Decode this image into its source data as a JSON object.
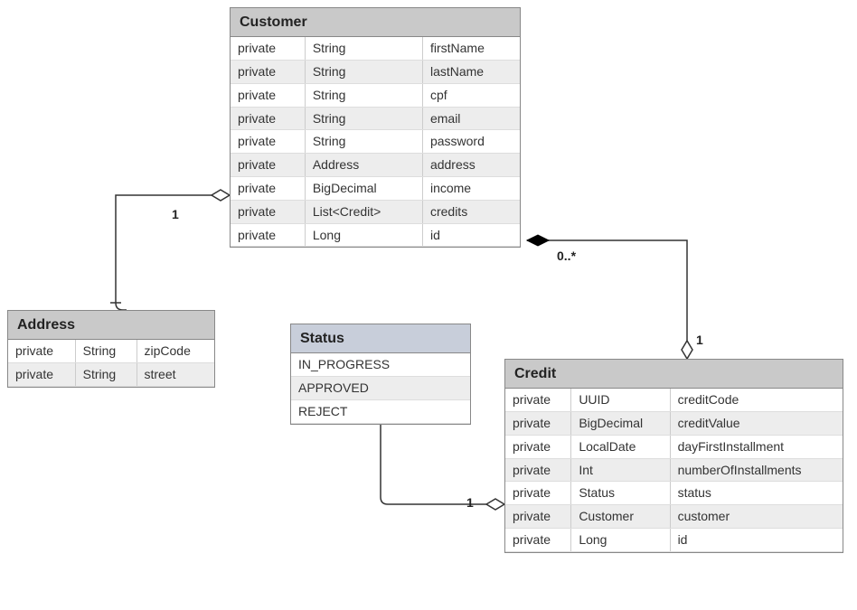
{
  "classes": {
    "customer": {
      "name": "Customer",
      "attributes": [
        {
          "vis": "private",
          "type": "String",
          "name": "firstName"
        },
        {
          "vis": "private",
          "type": "String",
          "name": "lastName"
        },
        {
          "vis": "private",
          "type": "String",
          "name": "cpf"
        },
        {
          "vis": "private",
          "type": "String",
          "name": "email"
        },
        {
          "vis": "private",
          "type": "String",
          "name": "password"
        },
        {
          "vis": "private",
          "type": "Address",
          "name": "address"
        },
        {
          "vis": "private",
          "type": "BigDecimal",
          "name": "income"
        },
        {
          "vis": "private",
          "type": "List<Credit>",
          "name": "credits"
        },
        {
          "vis": "private",
          "type": "Long",
          "name": "id"
        }
      ]
    },
    "address": {
      "name": "Address",
      "attributes": [
        {
          "vis": "private",
          "type": "String",
          "name": "zipCode"
        },
        {
          "vis": "private",
          "type": "String",
          "name": "street"
        }
      ]
    },
    "status": {
      "name": "Status",
      "values": [
        "IN_PROGRESS",
        "APPROVED",
        "REJECT"
      ]
    },
    "credit": {
      "name": "Credit",
      "attributes": [
        {
          "vis": "private",
          "type": "UUID",
          "name": "creditCode"
        },
        {
          "vis": "private",
          "type": "BigDecimal",
          "name": "creditValue"
        },
        {
          "vis": "private",
          "type": "LocalDate",
          "name": "dayFirstInstallment"
        },
        {
          "vis": "private",
          "type": "Int",
          "name": "numberOfInstallments"
        },
        {
          "vis": "private",
          "type": "Status",
          "name": "status"
        },
        {
          "vis": "private",
          "type": "Customer",
          "name": "customer"
        },
        {
          "vis": "private",
          "type": "Long",
          "name": "id"
        }
      ]
    }
  },
  "multiplicities": {
    "customer_address": "1",
    "customer_credit_near_customer": "0..*",
    "customer_credit_near_credit": "1",
    "credit_status": "1"
  }
}
